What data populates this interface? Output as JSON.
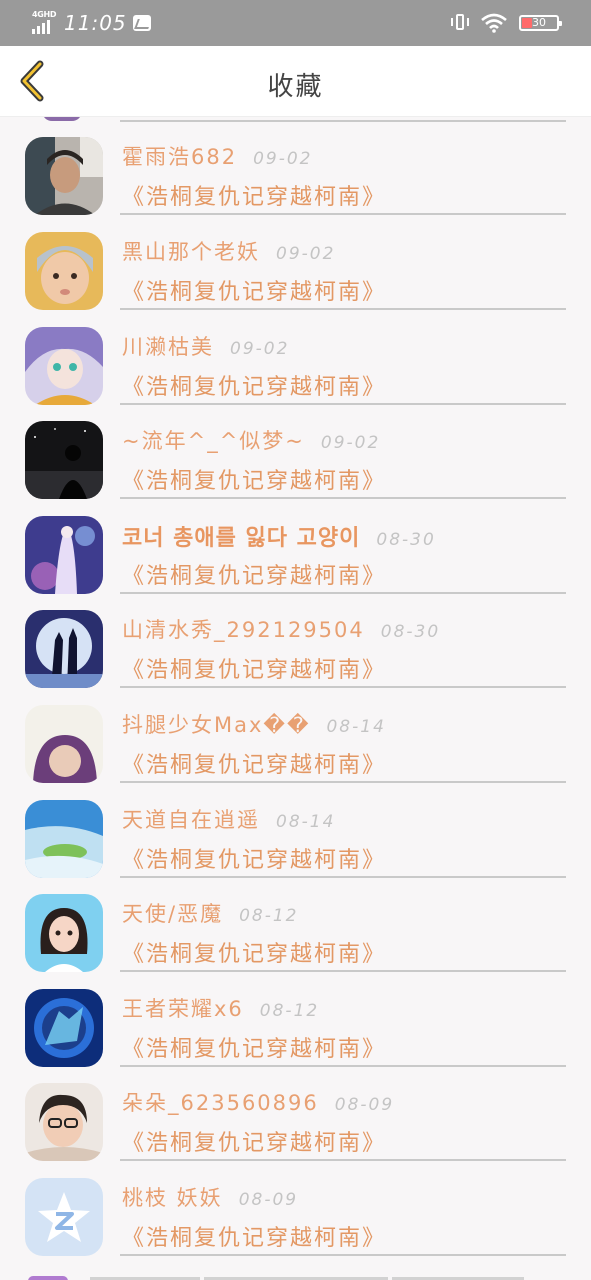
{
  "status_bar": {
    "network": "4GHD",
    "time": "11:05",
    "battery": "30"
  },
  "header": {
    "title": "收藏"
  },
  "items": [
    {
      "name": "霍雨浩682",
      "date": "09-02",
      "subtitle": "《浩桐复仇记穿越柯南》"
    },
    {
      "name": "黑山那个老妖",
      "date": "09-02",
      "subtitle": "《浩桐复仇记穿越柯南》"
    },
    {
      "name": "川濑枯美",
      "date": "09-02",
      "subtitle": "《浩桐复仇记穿越柯南》"
    },
    {
      "name": "~流年^_^似梦~",
      "date": "09-02",
      "subtitle": "《浩桐复仇记穿越柯南》"
    },
    {
      "name": "코너 총애를 잃다 고양이",
      "date": "08-30",
      "subtitle": "《浩桐复仇记穿越柯南》"
    },
    {
      "name": "山清水秀_292129504",
      "date": "08-30",
      "subtitle": "《浩桐复仇记穿越柯南》"
    },
    {
      "name": "抖腿少女Max��",
      "date": "08-14",
      "subtitle": "《浩桐复仇记穿越柯南》"
    },
    {
      "name": "天道自在逍遥",
      "date": "08-14",
      "subtitle": "《浩桐复仇记穿越柯南》"
    },
    {
      "name": "天使/恶魔",
      "date": "08-12",
      "subtitle": "《浩桐复仇记穿越柯南》"
    },
    {
      "name": "王者荣耀x6",
      "date": "08-12",
      "subtitle": "《浩桐复仇记穿越柯南》"
    },
    {
      "name": "朵朵_623560896",
      "date": "08-09",
      "subtitle": "《浩桐复仇记穿越柯南》"
    },
    {
      "name": "桃枝 妖妖",
      "date": "08-09",
      "subtitle": "《浩桐复仇记穿越柯南》"
    }
  ],
  "colors": {
    "accent": "#e39864",
    "date": "#c4c4c4",
    "divider": "#c9c9c9",
    "statusbar": "#9a9a9a"
  }
}
